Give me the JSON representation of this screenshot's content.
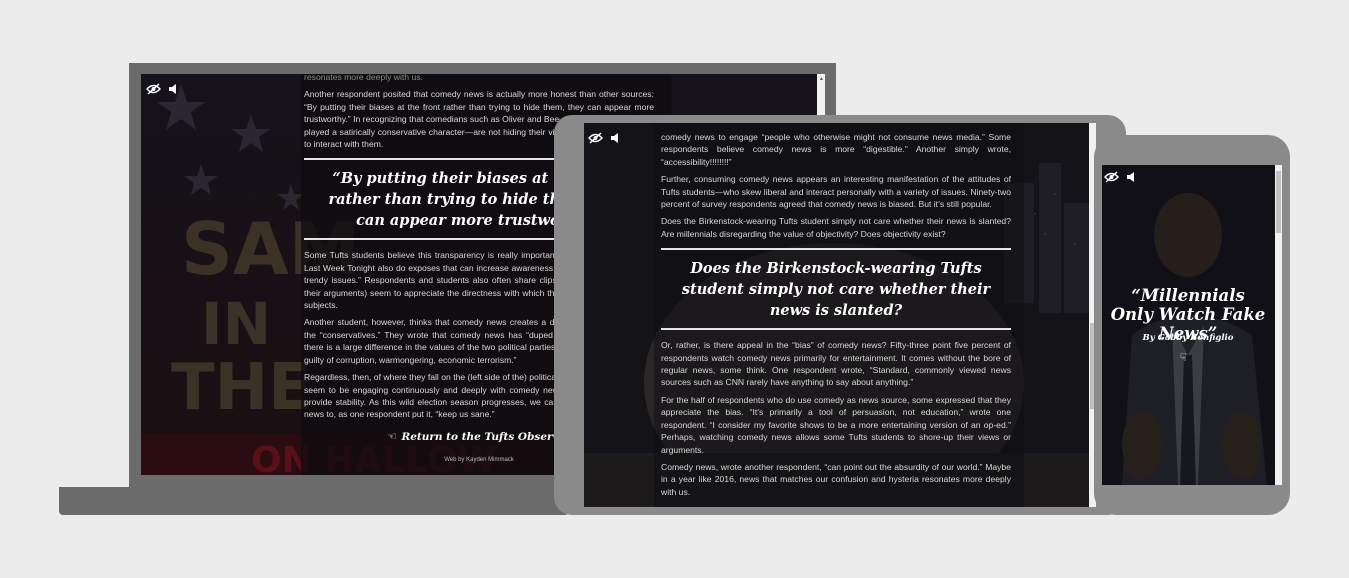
{
  "laptop": {
    "paragraphs_top": [
      "resonates more deeply with us.",
      "Another respondent posited that comedy news is actually more honest than other sources: “By putting their biases at the front rather than trying to hide them, they can appear more trustworthy.” In recognizing that comedians such as Oliver and Bee—and even Colbert, who played a satirically conservative character—are not hiding their views, some feel more able to interact with them."
    ],
    "pullquote": "“By putting their biases at the front rather than trying to hide them, they can appear more trustworthy”",
    "paragraphs_bottom": [
      "Some Tufts students believe this transparency is really important. One wrote, “Shows like Last Week Tonight also do exposes that can increase awareness of less well known or less trendy issues.” Respondents and students also often share clips on Facebook to support their arguments) seem to appreciate the directness with which these shows approach their subjects.",
      "Another student, however, thinks that comedy news creates a divide of “liberal” views vs. the “conservatives.” They wrote that comedy news has “duped neoliberals into believing there is a large difference in the values of the two political parties, instead, both parties are guilty of corruption, warmongering, economic terrorism.”",
      "Regardless, then, of where they fall on the (left side of the) political spectrum, Tufts students seem to be engaging continuously and deeply with comedy news. Perhaps these shows provide stability. As this wild election season progresses, we can count on comics on the news to, as one respondent put it, “keep us sane.”"
    ],
    "return_link": "Return to the Tufts Observer",
    "credit": "Web by Kayden Mimmack"
  },
  "tablet": {
    "paragraphs_top": [
      "comedy news to engage “people who otherwise might not consume news media.” Some respondents believe comedy news is more “digestible.” Another simply wrote, “accessibility!!!!!!!!”",
      "Further, consuming comedy news appears an interesting manifestation of the attitudes of Tufts students—who skew liberal and interact personally with a variety of issues. Ninety-two percent of survey respondents agreed that comedy news is biased. But it’s still popular.",
      "Does the Birkenstock-wearing Tufts student simply not care whether their news is slanted? Are millennials disregarding the value of objectivity? Does objectivity exist?"
    ],
    "pullquote": "Does the Birkenstock-wearing Tufts student simply not care whether their news is slanted?",
    "paragraphs_bottom": [
      "Or, rather, is there appeal in the “bias” of comedy news? Fifty-three point five percent of respondents watch comedy news primarily for entertainment. It comes without the bore of regular news, some think. One respondent wrote, “Standard, commonly viewed news sources such as CNN rarely have anything to say about anything.”",
      "For the half of respondents who do use comedy as news source, some expressed that they appreciate the bias. “It’s primarily a tool of persuasion, not education,” wrote one respondent. “I consider my favorite shows to be a more entertaining version of an op-ed.” Perhaps, watching comedy news allows some Tufts students to shore-up their views or arguments.",
      "Comedy news, wrote another respondent, “can point out the absurdity of our world.” Maybe in a year like 2016, news that matches our confusion and hysteria resonates more deeply with us."
    ]
  },
  "phone": {
    "title": "“Millennials Only Watch Fake News”",
    "byline": "By Gabby Bonfiglio",
    "scroll_hint_icon": "pointer-hand-icon"
  },
  "icons": {
    "visibility": "eye-slash-icon",
    "sound": "speaker-icon",
    "return": "pointer-hand-icon"
  },
  "colors": {
    "page_bg": "#ececec",
    "device_shell": "#6b6b6b",
    "tablet_shell": "#8a8a8a",
    "screen_bg": "#0f0d10"
  }
}
